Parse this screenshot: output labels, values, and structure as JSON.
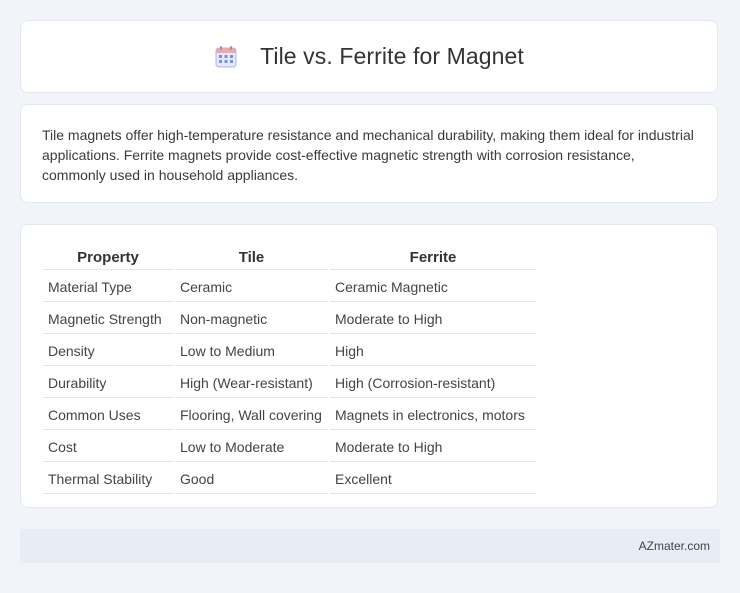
{
  "header": {
    "title": "Tile vs. Ferrite for Magnet",
    "icon": "calendar-icon"
  },
  "description": {
    "text": "Tile magnets offer high-temperature resistance and mechanical durability, making them ideal for industrial applications. Ferrite magnets provide cost-effective magnetic strength with corrosion resistance, commonly used in household appliances."
  },
  "table": {
    "headers": [
      "Property",
      "Tile",
      "Ferrite"
    ],
    "rows": [
      [
        "Material Type",
        "Ceramic",
        "Ceramic Magnetic"
      ],
      [
        "Magnetic Strength",
        "Non-magnetic",
        "Moderate to High"
      ],
      [
        "Density",
        "Low to Medium",
        "High"
      ],
      [
        "Durability",
        "High (Wear-resistant)",
        "High (Corrosion-resistant)"
      ],
      [
        "Common Uses",
        "Flooring, Wall covering",
        "Magnets in electronics, motors"
      ],
      [
        "Cost",
        "Low to Moderate",
        "Moderate to High"
      ],
      [
        "Thermal Stability",
        "Good",
        "Excellent"
      ]
    ]
  },
  "footer": {
    "text": "AZmater.com"
  },
  "colors": {
    "background": "#f1f4f9",
    "card": "#ffffff",
    "footer": "#e7ecf5",
    "icon_accent": "#7b8ef0"
  }
}
